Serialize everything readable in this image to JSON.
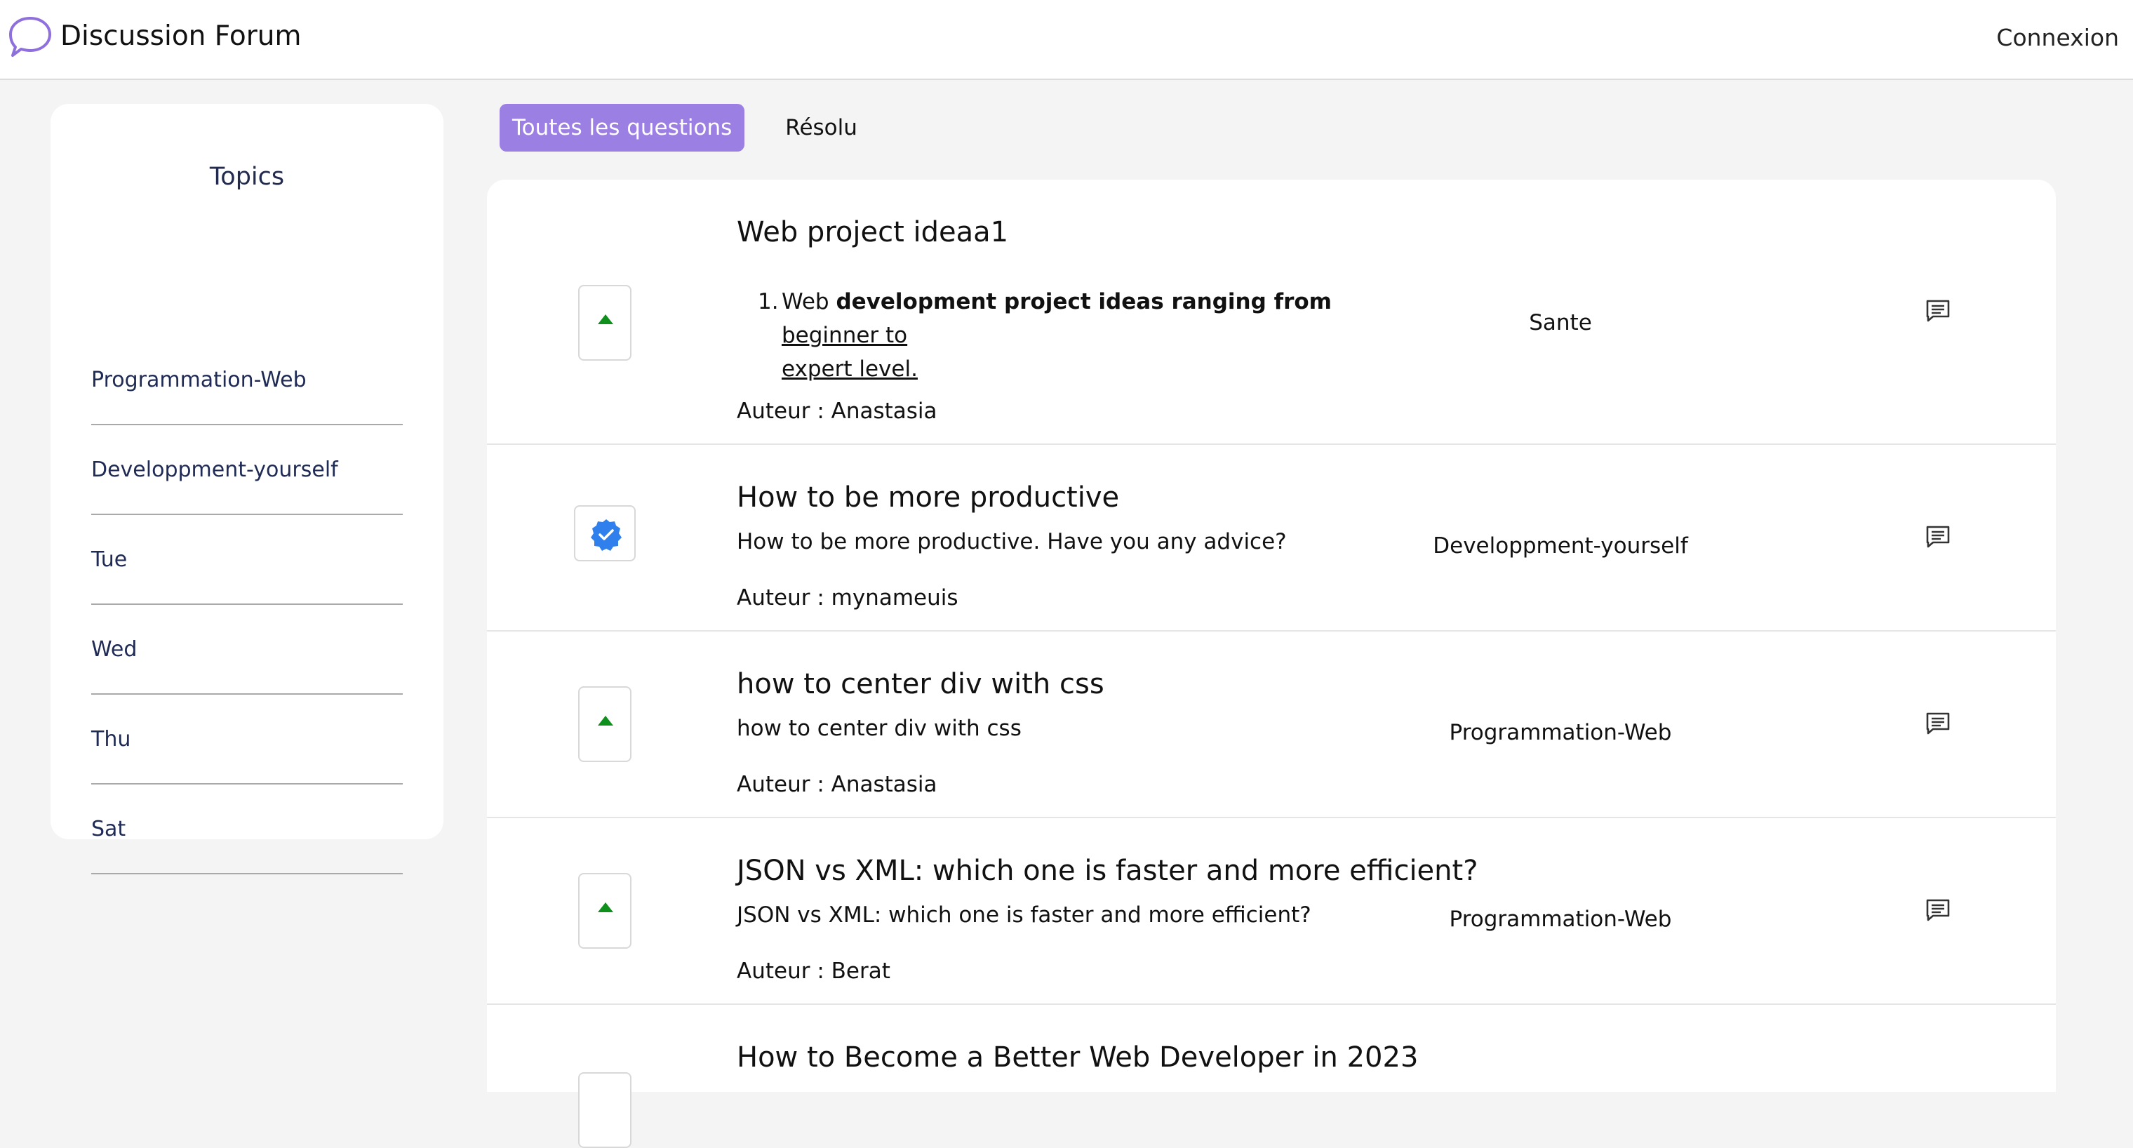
{
  "app": {
    "title": "Discussion Forum",
    "login_label": "Connexion",
    "logo_icon": "speech-bubble-icon",
    "accent_color": "#9c7fe3"
  },
  "sidebar": {
    "title": "Topics",
    "items": [
      {
        "label": "Programmation-Web"
      },
      {
        "label": "Developpment-yourself"
      },
      {
        "label": "Tue"
      },
      {
        "label": "Wed"
      },
      {
        "label": "Thu"
      },
      {
        "label": "Sat"
      }
    ]
  },
  "tabs": {
    "all_label": "Toutes les questions",
    "solved_label": "Résolu",
    "active": "Toutes les questions"
  },
  "questions": [
    {
      "title": "Web project ideaa1",
      "body_list": {
        "number": "1.",
        "plain": "Web ",
        "bold": "development project ideas ranging from",
        "underlined_1": "beginner to",
        "underlined_2": "expert level."
      },
      "author": "Auteur : Anastasia",
      "topic": "Sante",
      "status_icon": "upvote-arrow-icon"
    },
    {
      "title": "How to be more productive",
      "body": "How to be more productive. Have you any advice?",
      "author": "Auteur : mynameuis",
      "topic": "Developpment-yourself",
      "status_icon": "verified-badge-icon"
    },
    {
      "title": "how to center div with css",
      "body": "how to center div with css",
      "author": "Auteur : Anastasia",
      "topic": "Programmation-Web",
      "status_icon": "upvote-arrow-icon"
    },
    {
      "title": "JSON vs XML: which one is faster and more efficient?",
      "body": "JSON vs XML: which one is faster and more efficient?",
      "author": "Auteur : Berat",
      "topic": "Programmation-Web",
      "status_icon": "upvote-arrow-icon"
    },
    {
      "title": "How to Become a Better Web Developer in 2023",
      "status_icon": "upvote-arrow-icon"
    }
  ]
}
